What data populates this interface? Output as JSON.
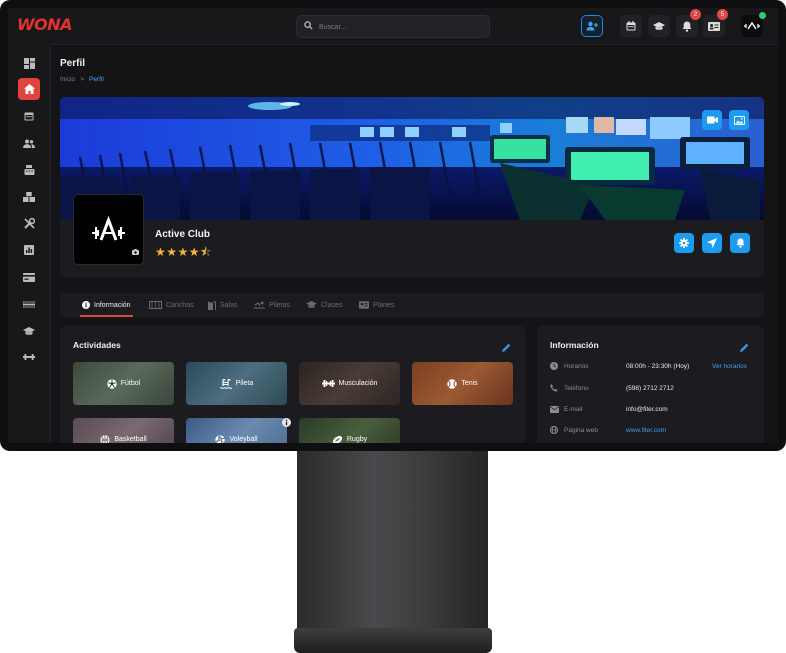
{
  "app": {
    "logo": "WONA"
  },
  "search": {
    "placeholder": "Buscar..."
  },
  "topbar": {
    "notifications_count": "2",
    "messages_count": "5"
  },
  "page": {
    "title": "Perfil",
    "breadcrumb": {
      "home": "Inicio",
      "separator": ">",
      "current": "Perfil"
    }
  },
  "club": {
    "name": "Active Club",
    "stars": "★★★★⯪",
    "rating": 4.5
  },
  "tabs": [
    {
      "label": "Información",
      "icon": "info-icon"
    },
    {
      "label": "Canchas",
      "icon": "court-icon"
    },
    {
      "label": "Salas",
      "icon": "door-icon"
    },
    {
      "label": "Piletas",
      "icon": "swim-icon"
    },
    {
      "label": "Clases",
      "icon": "graduation-cap-icon"
    },
    {
      "label": "Planes",
      "icon": "id-card-icon"
    }
  ],
  "activities": {
    "title": "Actividades",
    "items": [
      {
        "label": "Fútbol",
        "icon": "soccer-ball-icon"
      },
      {
        "label": "Pileta",
        "icon": "pool-icon"
      },
      {
        "label": "Musculación",
        "icon": "dumbbell-icon"
      },
      {
        "label": "Tenis",
        "icon": "tennis-ball-icon"
      },
      {
        "label": "Basketball",
        "icon": "basketball-icon"
      },
      {
        "label": "Voleyball",
        "icon": "volleyball-icon"
      },
      {
        "label": "Rugby",
        "icon": "rugby-ball-icon"
      }
    ]
  },
  "info": {
    "title": "Información",
    "rows": [
      {
        "label": "Horarios",
        "value": "08:00h - 23:30h (Hoy)",
        "extra": "Ver horarios"
      },
      {
        "label": "Teléfono",
        "value": "(598) 2712 2712"
      },
      {
        "label": "E-mail",
        "value": "info@fiter.com"
      },
      {
        "label": "Página web",
        "value": "www.fiter.com"
      }
    ]
  },
  "colors": {
    "accent_blue": "#1d9bf0",
    "accent_red": "#e0443f",
    "star": "#f5b82e",
    "background": "#141417",
    "card": "#1c1c20"
  }
}
